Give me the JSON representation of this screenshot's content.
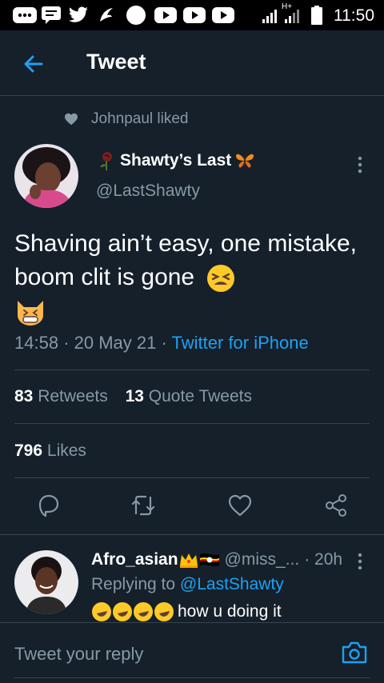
{
  "status_bar": {
    "time": "11:50",
    "network": "H+",
    "icons": [
      "messages-icon",
      "chat-icon",
      "twitter-icon",
      "app-icon",
      "circle-icon",
      "youtube-icon",
      "youtube-icon",
      "youtube-icon",
      "signal-icon",
      "battery-icon"
    ]
  },
  "header": {
    "title": "Tweet",
    "back_icon": "arrow-left-icon"
  },
  "social_context": {
    "text": "Johnpaul liked",
    "icon": "heart-icon"
  },
  "tweet": {
    "author_name": "Shawty’s Last",
    "author_handle": "@LastShawty",
    "text": "Shaving ain’t easy, one mistake, boom clit is gone",
    "time": "14:58",
    "date": "20 May 21",
    "source": "Twitter for iPhone",
    "retweets": "83",
    "retweets_label": "Retweets",
    "quotes": "13",
    "quotes_label": "Quote Tweets",
    "likes": "796",
    "likes_label": "Likes"
  },
  "actions": [
    "reply-icon",
    "retweet-icon",
    "like-icon",
    "share-icon"
  ],
  "reply": {
    "author_name": "Afro_asian",
    "author_handle": "@miss_...",
    "time": "· 20h",
    "replying_prefix": "Replying to",
    "replying_to": "@LastShawty",
    "text": "how u doing it"
  },
  "composer": {
    "placeholder": "Tweet your reply"
  },
  "colors": {
    "background": "#15202b",
    "accent": "#1da1f2",
    "muted": "#8899a6",
    "divider": "#38444d"
  }
}
